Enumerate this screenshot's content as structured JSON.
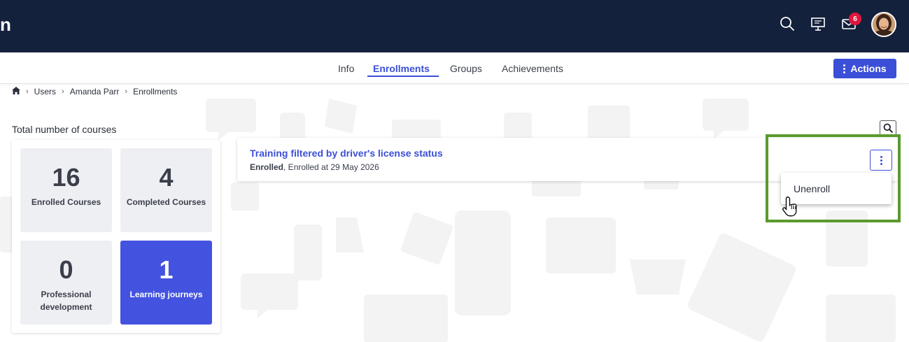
{
  "header": {
    "brand_fragment": "n",
    "icons": [
      "search-icon",
      "presentation-icon",
      "mail-icon"
    ],
    "mail_badge": "6",
    "avatar": "user-avatar"
  },
  "tabs": {
    "items": [
      {
        "label": "Info",
        "active": false
      },
      {
        "label": "Enrollments",
        "active": true
      },
      {
        "label": "Groups",
        "active": false
      },
      {
        "label": "Achievements",
        "active": false
      }
    ],
    "actions_label": "Actions"
  },
  "breadcrumb": {
    "home_icon": "home-icon",
    "items": [
      "Users",
      "Amanda Parr",
      "Enrollments"
    ]
  },
  "stats": {
    "title": "Total number of courses",
    "cards": [
      {
        "value": "16",
        "label": "Enrolled Courses"
      },
      {
        "value": "4",
        "label": "Completed Courses"
      },
      {
        "value": "0",
        "label": "Professional development"
      },
      {
        "value": "1",
        "label": "Learning journeys"
      }
    ]
  },
  "course": {
    "title": "Training filtered by driver's license status",
    "status": "Enrolled",
    "enrolled_text": ", Enrolled at 29 May 2026"
  },
  "menu": {
    "items": [
      "Unenroll"
    ]
  },
  "colors": {
    "topbar": "#14213d",
    "accent": "#3b4fd8",
    "highlight_card": "#4353e0",
    "annotation_frame": "#5a9a2e",
    "badge": "#e0163c"
  }
}
